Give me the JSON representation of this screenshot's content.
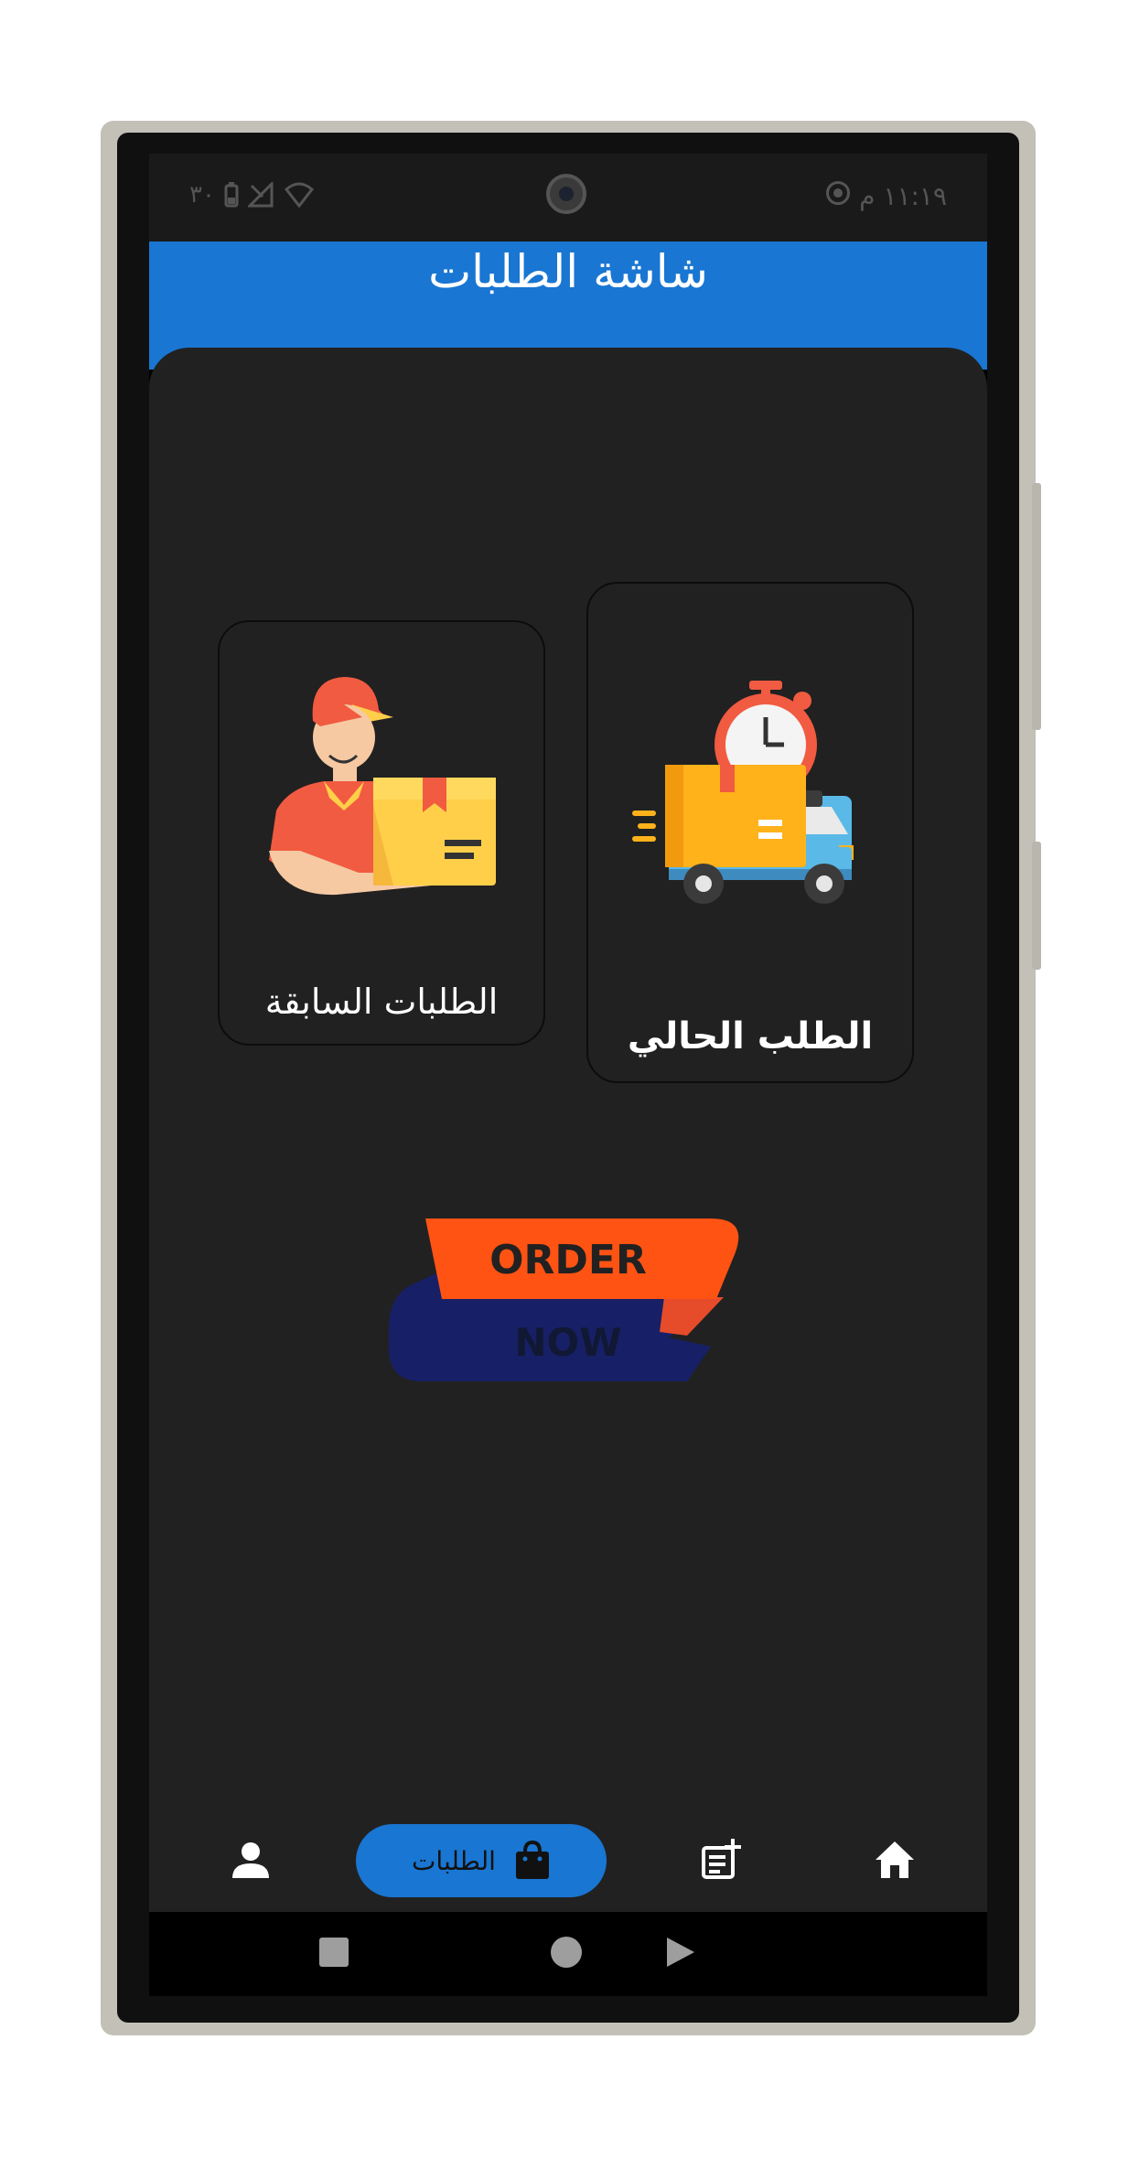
{
  "status_bar": {
    "time": "١١:١٩ م",
    "battery": "٣٠"
  },
  "app_bar": {
    "title": "شاشة الطلبات"
  },
  "cards": {
    "current_order": {
      "label": "الطلب الحالي",
      "icon": "delivery-truck-icon"
    },
    "previous_orders": {
      "label": "الطلبات السابقة",
      "icon": "delivery-man-icon"
    }
  },
  "banner": {
    "line1": "ORDER",
    "line2": "NOW"
  },
  "bottom_nav": {
    "items": [
      {
        "icon": "home-icon",
        "label": ""
      },
      {
        "icon": "add-note-icon",
        "label": ""
      },
      {
        "icon": "shopping-bag-icon",
        "label": "الطلبات",
        "active": true
      },
      {
        "icon": "person-icon",
        "label": ""
      }
    ]
  },
  "colors": {
    "primary": "#1976d2",
    "background": "#212121",
    "banner_orange": "#ff5314",
    "banner_navy": "#172066"
  }
}
